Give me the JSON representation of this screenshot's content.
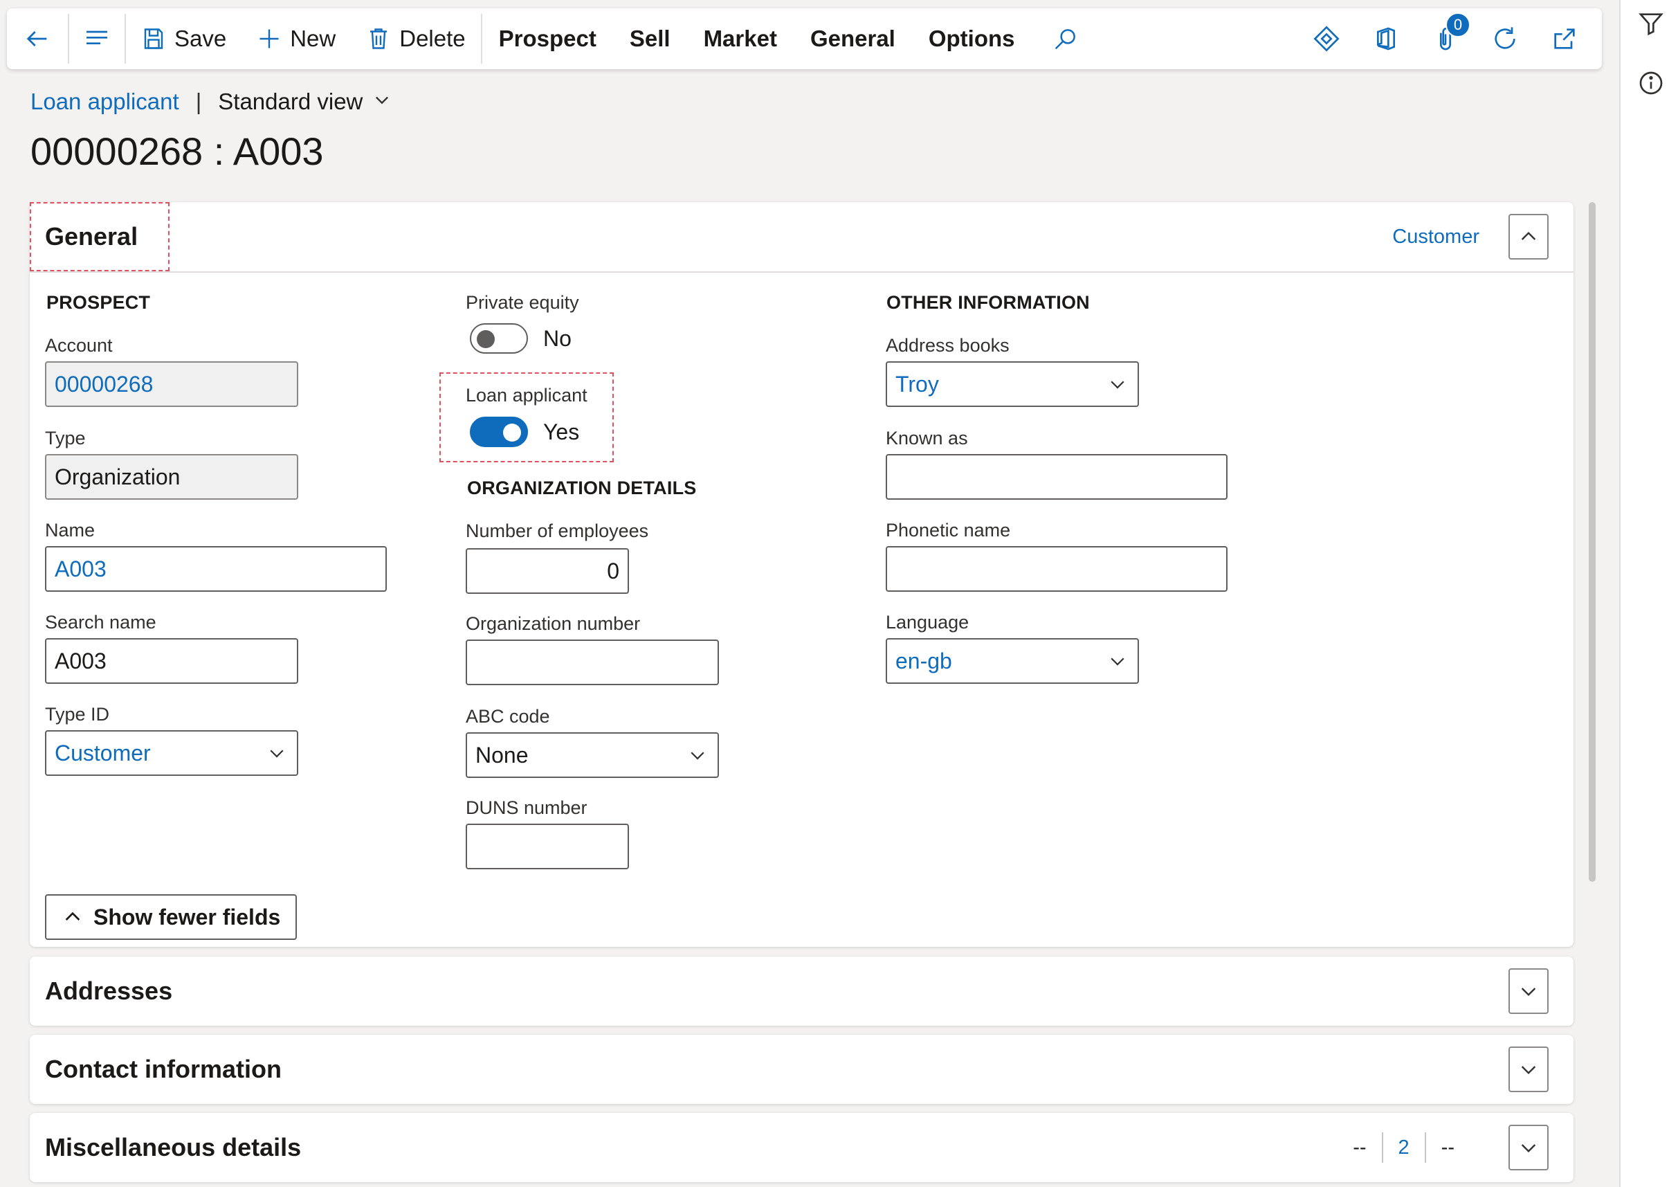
{
  "action_pane": {
    "save_label": "Save",
    "new_label": "New",
    "delete_label": "Delete",
    "menus": [
      "Prospect",
      "Sell",
      "Market",
      "General",
      "Options"
    ],
    "attachments_count": "0"
  },
  "header": {
    "breadcrumb_link": "Loan applicant",
    "separator": "|",
    "view_name": "Standard view",
    "title": "00000268 : A003"
  },
  "general": {
    "title": "General",
    "summary": "Customer",
    "prospect": {
      "heading": "PROSPECT",
      "account_label": "Account",
      "account_value": "00000268",
      "type_label": "Type",
      "type_value": "Organization",
      "name_label": "Name",
      "name_value": "A003",
      "search_name_label": "Search name",
      "search_name_value": "A003",
      "type_id_label": "Type ID",
      "type_id_value": "Customer"
    },
    "middle": {
      "private_equity_label": "Private equity",
      "private_equity_value": "No",
      "loan_applicant_label": "Loan applicant",
      "loan_applicant_value": "Yes"
    },
    "org_details": {
      "heading": "ORGANIZATION DETAILS",
      "employees_label": "Number of employees",
      "employees_value": "0",
      "org_number_label": "Organization number",
      "org_number_value": "",
      "abc_label": "ABC code",
      "abc_value": "None",
      "duns_label": "DUNS number",
      "duns_value": ""
    },
    "other_info": {
      "heading": "OTHER INFORMATION",
      "address_books_label": "Address books",
      "address_books_value": "Troy",
      "known_as_label": "Known as",
      "known_as_value": "",
      "phonetic_label": "Phonetic name",
      "phonetic_value": "",
      "language_label": "Language",
      "language_value": "en-gb"
    },
    "show_fewer_label": "Show fewer fields"
  },
  "addresses": {
    "title": "Addresses"
  },
  "contact": {
    "title": "Contact information"
  },
  "misc": {
    "title": "Miscellaneous details",
    "pager_prev": "--",
    "pager_num": "2",
    "pager_next": "--"
  },
  "colors": {
    "accent": "#0f6cbd",
    "highlight": "#e0505f"
  }
}
